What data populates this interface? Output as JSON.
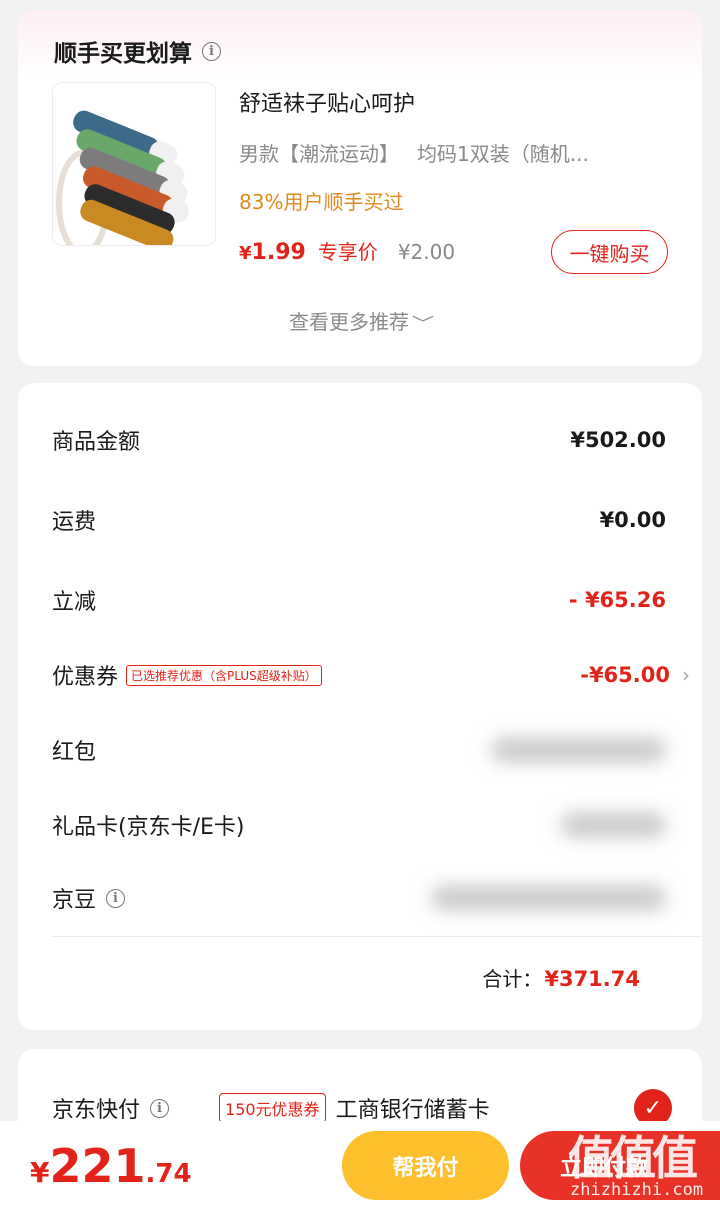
{
  "recommend": {
    "title": "顺手买更划算",
    "info_glyph": "i",
    "product": {
      "name": "舒适袜子贴心呵护",
      "spec_left": "男款【潮流运动】",
      "spec_right": "均码1双装（随机...",
      "rate": "83%用户顺手买过",
      "price_currency": "¥",
      "price_value": "1.99",
      "price_tag": "专享价",
      "old_price": "¥2.00",
      "buy_label": "一键购买"
    },
    "more_label": "查看更多推荐",
    "more_chevron": "﹀"
  },
  "summary": {
    "rows": [
      {
        "label": "商品金额",
        "value": "¥502.00"
      },
      {
        "label": "运费",
        "value": "¥0.00"
      },
      {
        "label": "立减",
        "value": "- ¥65.26"
      },
      {
        "label": "优惠券",
        "badge": "已选推荐优惠（含PLUS超级补贴）",
        "value": "-¥65.00",
        "arrow": "›"
      },
      {
        "label": "红包"
      },
      {
        "label": "礼品卡(京东卡/E卡)"
      },
      {
        "label": "京豆",
        "info_glyph": "i"
      }
    ],
    "total_label": "合计：",
    "total_value": "¥371.74"
  },
  "payment": {
    "label": "京东快付",
    "info_glyph": "i",
    "badge": "150元优惠券",
    "bank": "工商银行储蓄卡",
    "check_glyph": "✓"
  },
  "bottom_bar": {
    "currency": "¥",
    "amount_int": "221",
    "amount_dec": ".74",
    "help_label": "帮我付",
    "pay_label": "立即付款"
  },
  "watermark": {
    "logo": "值值值",
    "url": "zhizhizhi.com"
  },
  "colors": {
    "accent": "#e2231a",
    "orange": "#e08a1e",
    "help_button": "#fdbf2c",
    "background": "#f2f2f2"
  }
}
